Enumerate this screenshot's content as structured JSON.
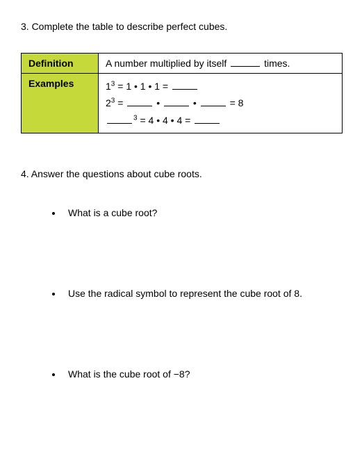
{
  "q3": {
    "prompt": "3. Complete the table to describe perfect cubes.",
    "row1": {
      "header": "Definition",
      "text_before": "A number multiplied by itself ",
      "text_after": " times."
    },
    "row2": {
      "header": "Examples",
      "line1_a": "1",
      "line1_b": " = 1 • 1 • 1 = ",
      "line2_a": "2",
      "line2_b": " = ",
      "line2_c": " • ",
      "line2_d": " • ",
      "line2_e": " = 8",
      "line3_a": " = 4 • 4 • 4 = "
    },
    "sup3": "3"
  },
  "q4": {
    "prompt": "4. Answer the questions about cube roots.",
    "bullets": [
      "What is a cube root?",
      "Use the radical symbol to represent the cube root of 8.",
      "What is the cube root of −8?"
    ]
  }
}
